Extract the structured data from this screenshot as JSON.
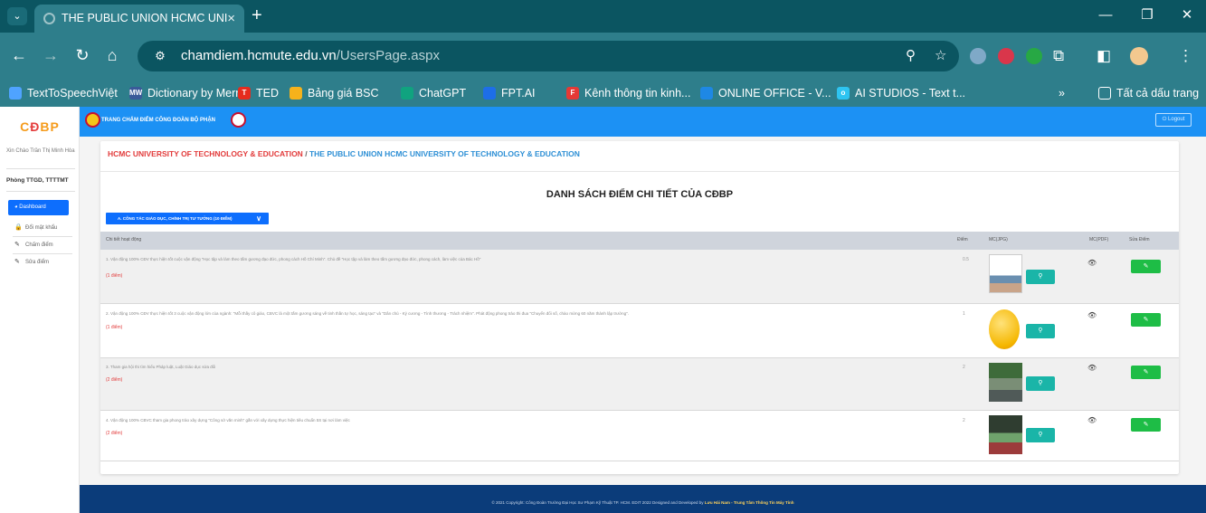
{
  "browser": {
    "tab_title": "THE PUBLIC UNION HCMC UNI",
    "tab_close": "×",
    "new_tab": "+",
    "url_host": "chamdiem.hcmute.edu.vn",
    "url_path": "/UsersPage.aspx",
    "bookmarks": [
      {
        "label": "TextToSpeechViệt",
        "icon_color": "#4fa3ff",
        "icon_text": ""
      },
      {
        "label": "Dictionary by Merri...",
        "icon_color": "#3a5a99",
        "icon_text": "MW"
      },
      {
        "label": "TED",
        "icon_color": "#e62b1e",
        "icon_text": "T"
      },
      {
        "label": "Bảng giá BSC",
        "icon_color": "#f6b21b",
        "icon_text": ""
      },
      {
        "label": "ChatGPT",
        "icon_color": "#10a37f",
        "icon_text": ""
      },
      {
        "label": "FPT.AI",
        "icon_color": "#1d6ee8",
        "icon_text": ""
      },
      {
        "label": "Kênh thông tin kinh...",
        "icon_color": "#e53935",
        "icon_text": "F"
      },
      {
        "label": "ONLINE OFFICE - V...",
        "icon_color": "#1e88e5",
        "icon_text": ""
      },
      {
        "label": "AI STUDIOS - Text t...",
        "icon_color": "#2ec4f1",
        "icon_text": "o"
      }
    ],
    "bookmarks_more": "»",
    "all_bookmarks": "Tất cả dấu trang"
  },
  "sidebar": {
    "brand_a": "C",
    "brand_b": "Đ",
    "brand_c": "BP",
    "greeting": "Xin Chào Trần Thị Minh Hòa",
    "department": "Phòng TTGD, TTTTMT",
    "active_item": "Dashboard",
    "items": [
      {
        "icon": "🔒",
        "label": "Đổi mật khẩu"
      },
      {
        "icon": "✎",
        "label": "Chấm điểm"
      },
      {
        "icon": "✎",
        "label": "Sửa điểm"
      }
    ]
  },
  "header": {
    "title": "TRANG CHẤM ĐIỂM CÔNG ĐOÀN BỘ PHẬN",
    "logout": "Logout"
  },
  "content": {
    "crumb_1": "HCMC UNIVERSITY OF TECHNOLOGY & EDUCATION",
    "crumb_sep": "/",
    "crumb_2": "THE PUBLIC UNION HCMC UNIVERSITY OF TECHNOLOGY & EDUCATION",
    "heading": "DANH SÁCH ĐIỂM CHI TIẾT CỦA CĐBP",
    "dropdown": "A. CÔNG TÁC GIÁO DỤC, CHÍNH TRỊ TƯ TƯỞNG (10 ĐIỂM)",
    "columns": {
      "detail": "Chi tiết hoạt động",
      "score": "Điểm",
      "mc_jpg": "MC(JPG)",
      "mc_pdf": "MC(PDF)",
      "edit": "Sửa Điểm"
    },
    "rows": [
      {
        "text": "1. Vận động 100% CĐV thực hiện tốt cuộc vận động \"Học tập và làm theo tấm gương đạo đức, phong cách Hồ Chí Minh\". Chủ đề \"Học tập và làm theo tấm gương đạo đức, phong cách, làm việc của Bác Hồ\"",
        "points": "(1 điểm)",
        "score": "0.5"
      },
      {
        "text": "2. Vận động 100% CĐV thực hiện tốt 3 cuộc vận động lớn của ngành: \"Mỗi thầy cô giáo, CBVC là một tấm gương sáng về tinh thần tự học, sáng tạo\" và \"Dân chủ - Kỷ cương - Tình thương - Trách nhiệm\". Phát động phong trào thi đua \"Chuyển đổi số, chào mừng 60 năm thành lập trường\".",
        "points": "(1 điểm)",
        "score": "1"
      },
      {
        "text": "3. Tham gia hội thi tìm hiểu Pháp luật, Luật Giáo dục sửa đổi",
        "points": "(2 điểm)",
        "score": "2"
      },
      {
        "text": "4. Vận động 100% CBVC tham gia phong trào xây dựng \"Công sở văn minh\" gắn với xây dựng thực hiện tiêu chuẩn 5S tại nơi làm việc",
        "points": "(2 điểm)",
        "score": "2"
      }
    ]
  },
  "footer": {
    "text": "© 2021 Copyright: Công Đoàn Trường Đại Học Sư Phạm Kỹ Thuật TP. HCM. EDIT 2022 Designed and Developed by",
    "author": "Lưu Hải Nam - Trung Tâm Thông Tin Máy Tính"
  }
}
